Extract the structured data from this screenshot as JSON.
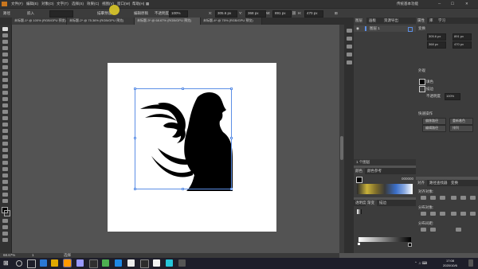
{
  "app": {
    "menu_items": [
      "文件(F)",
      "编辑(E)",
      "对象(O)",
      "文字(T)",
      "选择(S)",
      "效果(C)",
      "视图(V)",
      "窗口(W)",
      "帮助(H)"
    ],
    "workspace": "传统基本功能",
    "accent": "#5c8fe6"
  },
  "control_bar": {
    "object_label": "路径",
    "image_trace_label": "描摹预设",
    "embed_label": "嵌入",
    "edit_original_label": "编辑原稿",
    "opacity_label": "不透明度",
    "opacity_value": "100%",
    "x_value": "305.6 px",
    "y_value": "368 px",
    "w_value": "891 px",
    "h_value": "470 px"
  },
  "doc_tabs": [
    {
      "label": "未标题-1* @ 100% (RGB/GPU 预览)",
      "active": false
    },
    {
      "label": "未标题-2* @ 75.36% (RGB/GPU 预览)",
      "active": false
    },
    {
      "label": "未标题-3* @ 68.67% (RGB/GPU 预览)",
      "active": true
    },
    {
      "label": "未标题-4* @ 75% (RGB/GPU 预览)",
      "active": false
    }
  ],
  "status": {
    "zoom": "68.67%",
    "page": "1",
    "tool": "选择"
  },
  "layers_panel": {
    "tabs": [
      "图层",
      "画板",
      "资源导出"
    ],
    "layer_name": "图层 1",
    "footer": "1 个图层"
  },
  "properties_panel": {
    "tabs": [
      "属性",
      "库",
      "学习"
    ],
    "section_transform": "变换",
    "x": "305.6 px",
    "y": "368 px",
    "w": "891 px",
    "h": "470 px",
    "section_appearance": "外观",
    "fill_label": "填色",
    "stroke_label": "描边",
    "opacity_label": "不透明度",
    "opacity_value": "100%",
    "section_quick": "快速操作",
    "btn_1": "偏移路径",
    "btn_2": "重新着色",
    "btn_3": "编辑路径",
    "btn_4": "排列"
  },
  "color_panel": {
    "tabs": [
      "颜色",
      "颜色参考"
    ],
    "hex": "000000"
  },
  "gradient_panel": {
    "tabs": [
      "透明度",
      "渐变",
      "描边"
    ]
  },
  "align_panel": {
    "tabs": [
      "对齐",
      "路径查找器",
      "变换"
    ],
    "align_objects_label": "对齐对象:",
    "distribute_objects_label": "分布对象:",
    "distribute_spacing_label": "分布间距:"
  },
  "taskbar": {
    "time": "17:08",
    "date": "2020/10/6"
  }
}
